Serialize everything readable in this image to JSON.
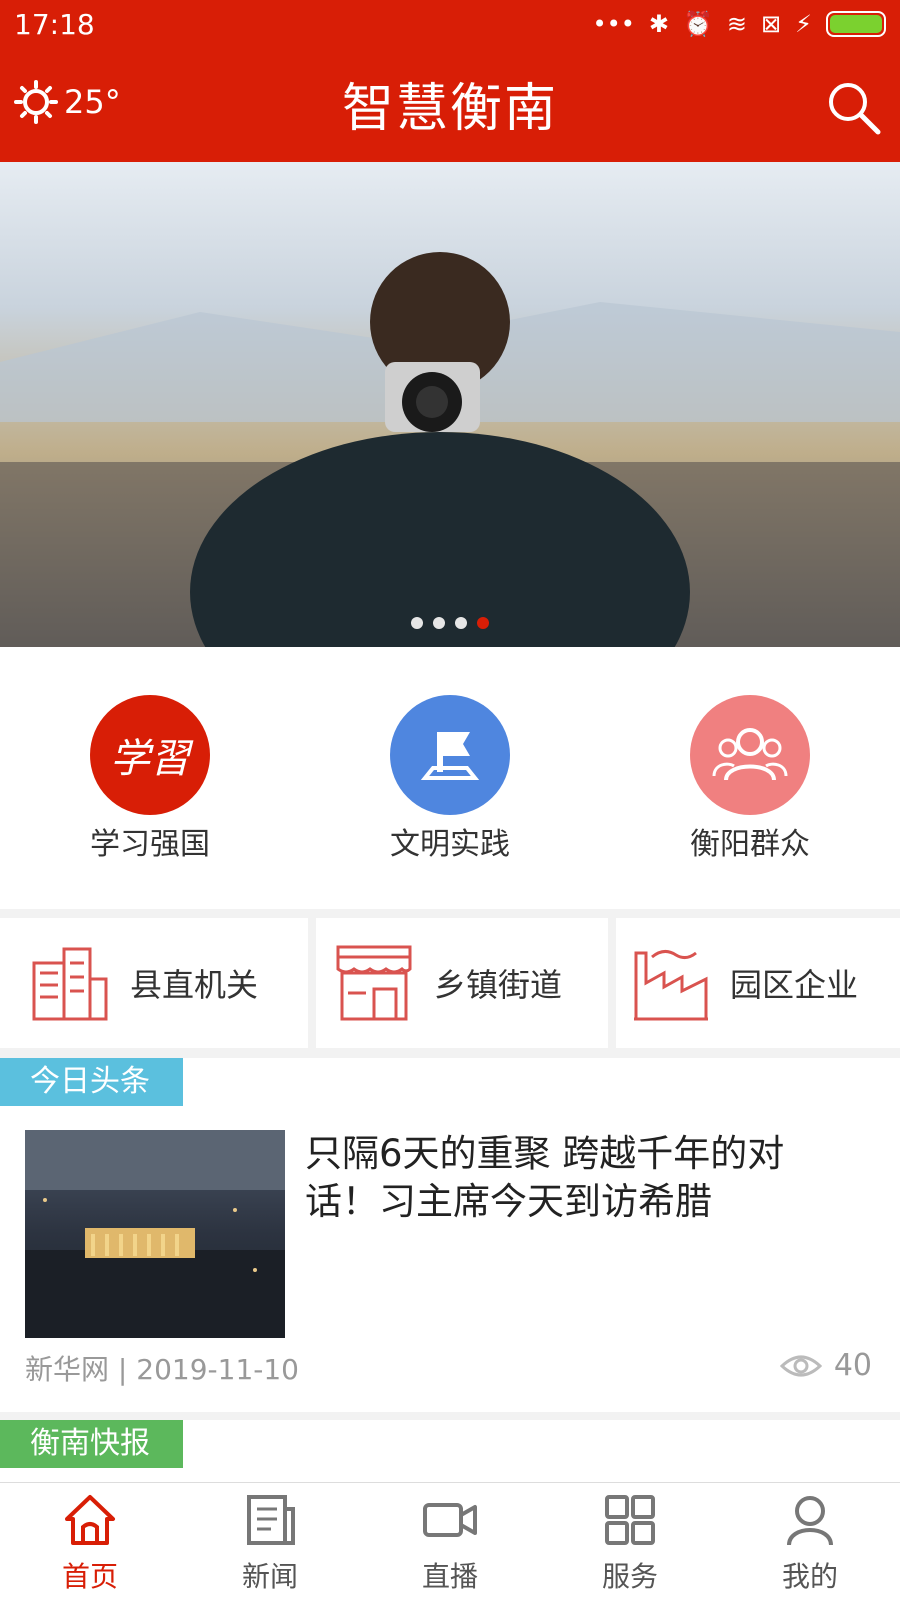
{
  "status_bar": {
    "time": "17:18"
  },
  "header": {
    "weather_temp": "25°",
    "title": "智慧衡南"
  },
  "banner": {
    "dots_count": 4,
    "active_dot": 4
  },
  "quick_links": [
    {
      "label": "学习强国",
      "icon_text": "学習",
      "color": "#d81e06"
    },
    {
      "label": "文明实践",
      "color": "#4f86df"
    },
    {
      "label": "衡阳群众",
      "color": "#f08080"
    }
  ],
  "categories": [
    {
      "label": "县直机关"
    },
    {
      "label": "乡镇街道"
    },
    {
      "label": "园区企业"
    }
  ],
  "news": {
    "section_tag": "今日头条",
    "headline": "只隔6天的重聚 跨越千年的对话！习主席今天到访希腊",
    "source": "新华网",
    "separator": "|",
    "date": "2019-11-10",
    "views": "40"
  },
  "news2": {
    "section_tag": "衡南快报"
  },
  "tabbar": [
    {
      "label": "首页",
      "active": true
    },
    {
      "label": "新闻"
    },
    {
      "label": "直播"
    },
    {
      "label": "服务"
    },
    {
      "label": "我的"
    }
  ],
  "colors": {
    "brand": "#d81e06"
  }
}
